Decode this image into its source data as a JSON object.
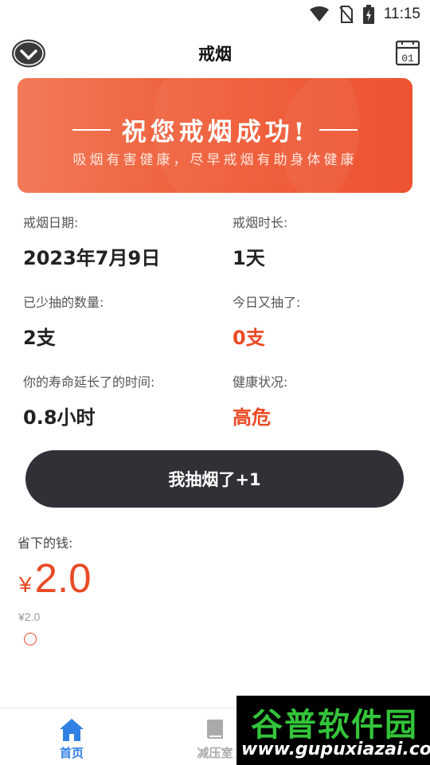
{
  "status_bar": {
    "time": "11:15"
  },
  "header": {
    "title": "戒烟"
  },
  "banner": {
    "title": "祝您戒烟成功!",
    "subtitle": "吸烟有害健康，尽早戒烟有助身体健康"
  },
  "stats": {
    "quit_date_label": "戒烟日期:",
    "quit_date_value": "2023年7月9日",
    "duration_label": "戒烟时长:",
    "duration_value": "1天",
    "fewer_label": "已少抽的数量:",
    "fewer_value": "2支",
    "today_label": "今日又抽了:",
    "today_value": "0支",
    "life_label": "你的寿命延长了的时间:",
    "life_value": "0.8小时",
    "health_label": "健康状况:",
    "health_value": "高危"
  },
  "action": {
    "smoke_button": "我抽烟了+1"
  },
  "savings": {
    "label": "省下的钱:",
    "currency": "¥",
    "amount": "2.0",
    "small": "¥2.0"
  },
  "nav": {
    "items": [
      {
        "label": "首页",
        "icon": "home-icon",
        "active": true
      },
      {
        "label": "减压室",
        "icon": "book-icon",
        "active": false
      }
    ]
  },
  "watermark": {
    "title": "谷普软件园",
    "url": "www.gupuxiazai.com"
  },
  "colors": {
    "accent": "#ea4a24",
    "nav_active": "#2f7fe5",
    "button_dark": "#323036"
  }
}
